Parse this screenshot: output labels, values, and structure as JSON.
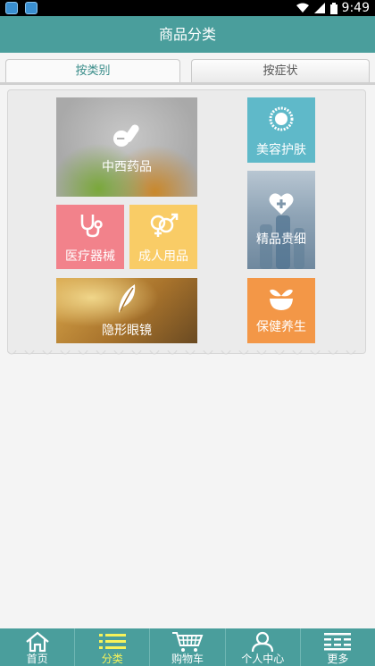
{
  "status_bar": {
    "time": "9:49"
  },
  "title_bar": {
    "title": "商品分类"
  },
  "tabs": [
    {
      "label": "按类别",
      "active": true
    },
    {
      "label": "按症状",
      "active": false
    }
  ],
  "categories": [
    {
      "label": "中西药品",
      "icon": "pill-capsule-icon",
      "color": "#a9a9a9"
    },
    {
      "label": "美容护肤",
      "icon": "sun-flower-icon",
      "color": "#5fb9c9"
    },
    {
      "label": "医疗器械",
      "icon": "stethoscope-icon",
      "color": "#f2828b"
    },
    {
      "label": "成人用品",
      "icon": "gender-symbols-icon",
      "color": "#f9cc66"
    },
    {
      "label": "精品贵细",
      "icon": "heart-plus-icon",
      "color": "#8fa4b6"
    },
    {
      "label": "隐形眼镜",
      "icon": "leaf-icon",
      "color": "#a8732c"
    },
    {
      "label": "保健养生",
      "icon": "herb-bowl-icon",
      "color": "#f39747"
    }
  ],
  "bottom_nav": [
    {
      "label": "首页",
      "icon": "home-icon",
      "active": false
    },
    {
      "label": "分类",
      "icon": "list-icon",
      "active": true
    },
    {
      "label": "购物车",
      "icon": "cart-icon",
      "active": false
    },
    {
      "label": "个人中心",
      "icon": "user-icon",
      "active": false
    },
    {
      "label": "更多",
      "icon": "more-grid-icon",
      "active": false
    }
  ],
  "colors": {
    "theme": "#4a9e9c",
    "active_nav_text": "#f7f35a"
  }
}
